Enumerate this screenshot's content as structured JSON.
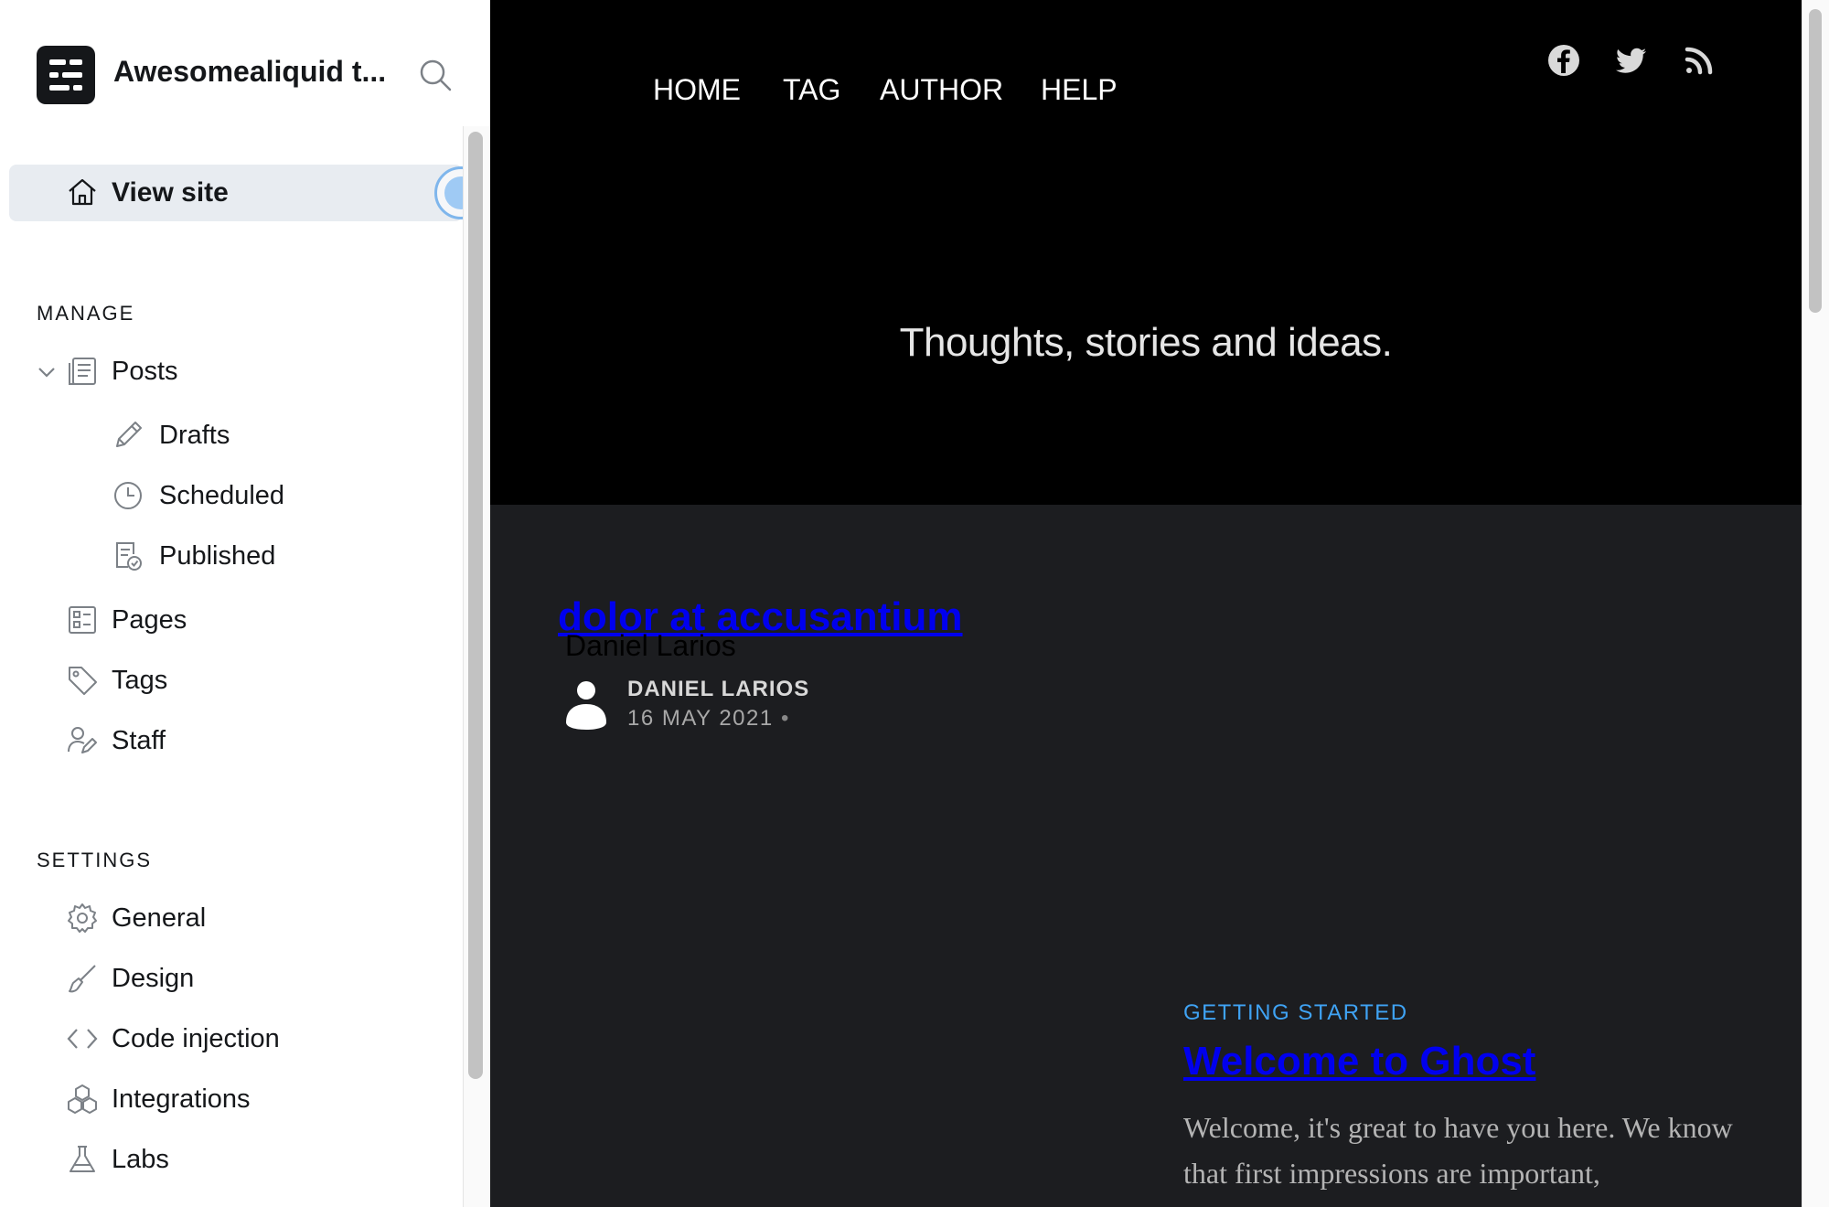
{
  "sidebar": {
    "brand_name": "Awesomealiquid t...",
    "view_site_label": "View site",
    "manage_title": "MANAGE",
    "settings_title": "SETTINGS",
    "manage_items": [
      {
        "label": "Posts",
        "icon": "posts-icon"
      },
      {
        "label": "Drafts",
        "icon": "pencil-icon"
      },
      {
        "label": "Scheduled",
        "icon": "clock-icon"
      },
      {
        "label": "Published",
        "icon": "published-icon"
      },
      {
        "label": "Pages",
        "icon": "pages-icon"
      },
      {
        "label": "Tags",
        "icon": "tag-icon"
      },
      {
        "label": "Staff",
        "icon": "staff-icon"
      }
    ],
    "settings_items": [
      {
        "label": "General",
        "icon": "gear-icon"
      },
      {
        "label": "Design",
        "icon": "brush-icon"
      },
      {
        "label": "Code injection",
        "icon": "code-icon"
      },
      {
        "label": "Integrations",
        "icon": "integrations-icon"
      },
      {
        "label": "Labs",
        "icon": "flask-icon"
      }
    ]
  },
  "site": {
    "nav": [
      "HOME",
      "TAG",
      "AUTHOR",
      "HELP"
    ],
    "social": [
      "facebook-icon",
      "twitter-icon",
      "rss-icon"
    ],
    "tagline": "Thoughts, stories and ideas.",
    "post1": {
      "title": "dolor at accusantium",
      "author_alt": "Daniel Larios",
      "author": "DANIEL LARIOS",
      "date": "16 MAY 2021",
      "separator": "•"
    },
    "post2": {
      "tag": "GETTING STARTED",
      "title": "Welcome to Ghost",
      "excerpt": "Welcome, it's great to have you here. We know that first impressions are important,"
    }
  },
  "colors": {
    "sidebar_bg": "#ffffff",
    "active_item_bg": "#e8ecf1",
    "hero_bg": "#000000",
    "content_bg": "#1c1d20",
    "link": "#0000ee",
    "tag_accent": "#3fa3f4"
  }
}
